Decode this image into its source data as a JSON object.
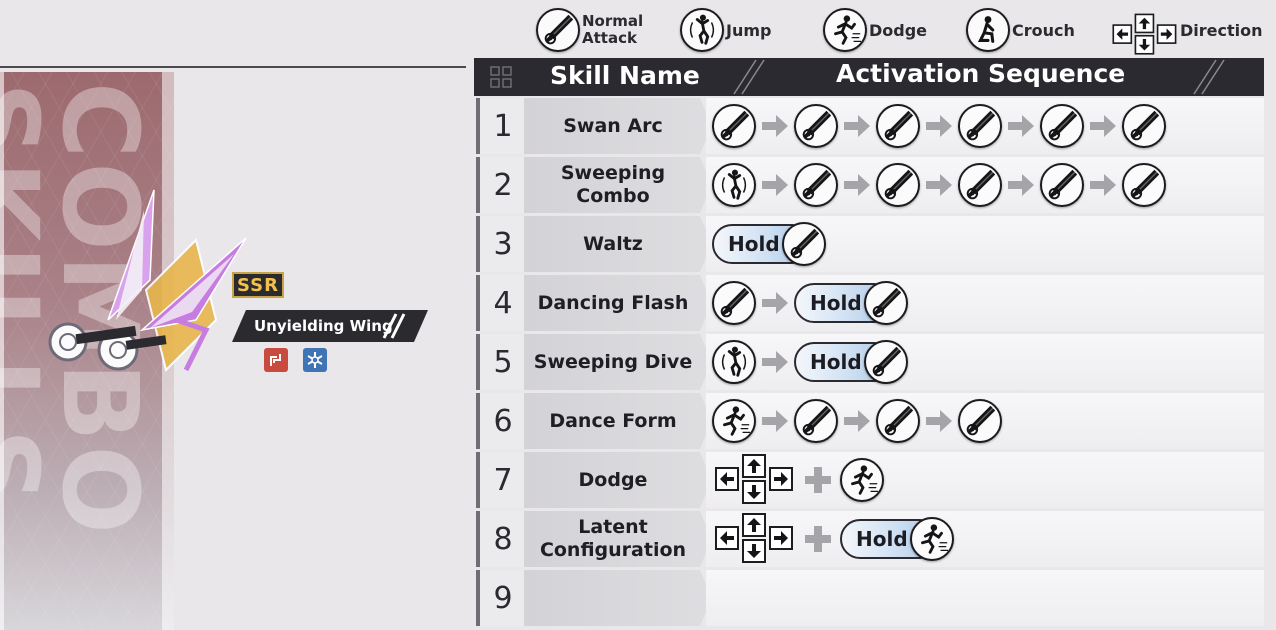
{
  "legend": [
    {
      "icon": "normal-attack-icon",
      "label": "Normal Attack"
    },
    {
      "icon": "jump-icon",
      "label": "Jump"
    },
    {
      "icon": "dodge-icon",
      "label": "Dodge"
    },
    {
      "icon": "crouch-icon",
      "label": "Crouch"
    },
    {
      "icon": "direction-icon",
      "label": "Direction"
    }
  ],
  "weapon": {
    "rarity": "SSR",
    "name": "Unyielding Wing",
    "background_text": "COMBO SKILLS",
    "elements": [
      "fire-element-icon",
      "ice-element-icon"
    ]
  },
  "table": {
    "header_name": "Skill Name",
    "header_sequence": "Activation Sequence",
    "hold_label": "Hold",
    "rows": [
      {
        "num": "1",
        "name": "Swan Arc"
      },
      {
        "num": "2",
        "name": "Sweeping Combo"
      },
      {
        "num": "3",
        "name": "Waltz"
      },
      {
        "num": "4",
        "name": "Dancing Flash"
      },
      {
        "num": "5",
        "name": "Sweeping Dive"
      },
      {
        "num": "6",
        "name": "Dance Form"
      },
      {
        "num": "7",
        "name": "Dodge"
      },
      {
        "num": "8",
        "name": "Latent Configuration"
      },
      {
        "num": "9",
        "name": ""
      }
    ]
  },
  "colors": {
    "header_bg": "#2b2a30",
    "hold_blue": "#a9c6e6",
    "ssr_gold": "#f2c14a",
    "weapon_purple": "#c77de0"
  }
}
